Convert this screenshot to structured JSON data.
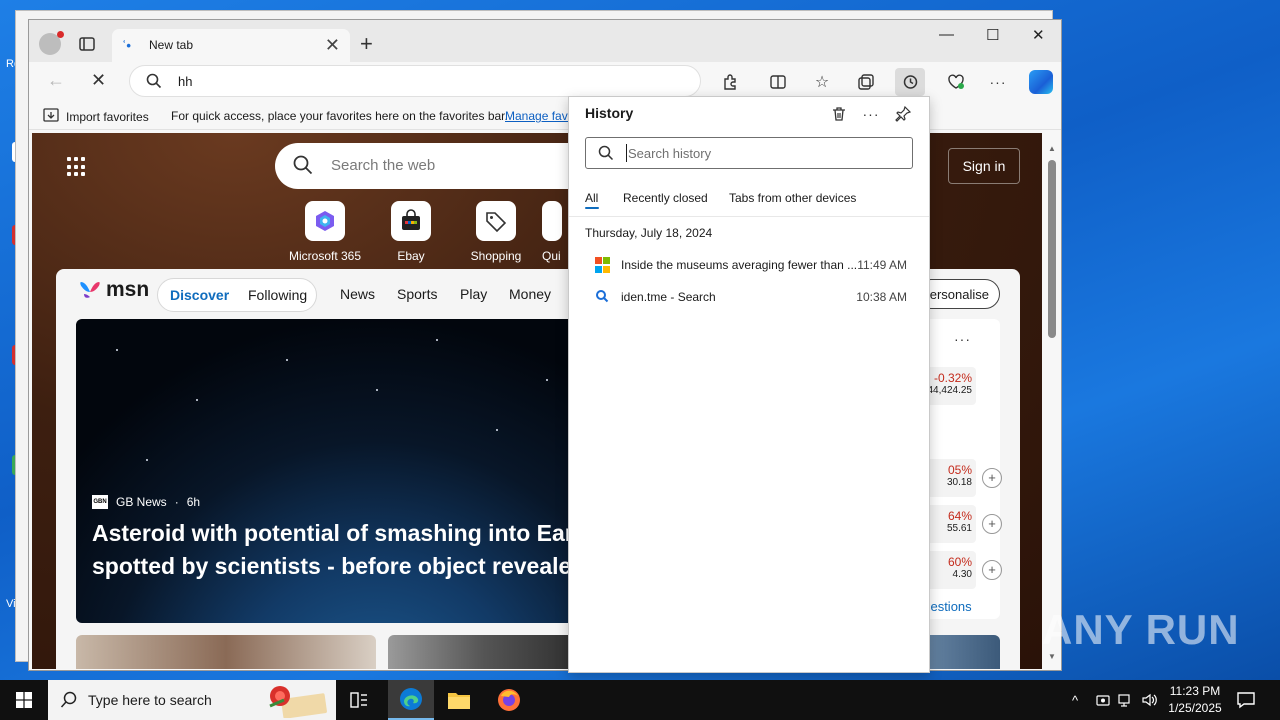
{
  "desktop": {
    "label_left_top": "Re",
    "label_left_bottom": "Vi"
  },
  "browser": {
    "tab": {
      "title": "New tab",
      "close_glyph": "✕"
    },
    "new_tab_glyph": "+",
    "window_controls": {
      "minimize": "—",
      "maximize": "☐",
      "close": "✕"
    },
    "address": {
      "value": "hh"
    },
    "favorites_bar": {
      "import_label": "Import favorites",
      "hint": "For quick access, place your favorites here on the favorites bar.",
      "manage_link": "Manage favo"
    }
  },
  "page": {
    "web_search_placeholder": "Search the web",
    "signin_label": "Sign in",
    "quick_links": [
      {
        "label": "Microsoft 365",
        "icon": "microsoft-365-icon"
      },
      {
        "label": "Ebay",
        "icon": "ebay-icon"
      },
      {
        "label": "Shopping",
        "icon": "shopping-tag-icon"
      },
      {
        "label": "Qui",
        "icon": "quick-link-icon"
      }
    ],
    "msn": {
      "logo_text": "msn",
      "pills": {
        "discover": "Discover",
        "following": "Following"
      },
      "nav": [
        "News",
        "Sports",
        "Play",
        "Money"
      ],
      "personalise": "ersonalise",
      "hero": {
        "source": "GB News",
        "age": "6h",
        "source_badge": "GBN",
        "title_line1": "Asteroid with potential of smashing into Ear",
        "title_line2": "spotted by scientists - before object reveale"
      },
      "stocks": {
        "headline": {
          "pct": "-0.32%",
          "value": "44,424.25"
        },
        "rows": [
          {
            "pct": "05%",
            "value": "30.18"
          },
          {
            "pct": "64%",
            "value": "55.61"
          },
          {
            "pct": "60%",
            "value": "4.30"
          }
        ],
        "suggestions_link": "ggestions"
      }
    }
  },
  "history": {
    "title": "History",
    "search_placeholder": "Search history",
    "tabs": {
      "all": "All",
      "recently_closed": "Recently closed",
      "other_devices": "Tabs from other devices"
    },
    "date_heading": "Thursday, July 18, 2024",
    "items": [
      {
        "title": "Inside the museums averaging fewer than ...",
        "time": "11:49 AM",
        "icon": "microsoft-logo-icon"
      },
      {
        "title": "iden.tme - Search",
        "time": "10:38 AM",
        "icon": "search-icon"
      }
    ]
  },
  "watermark": "ANY RUN",
  "taskbar": {
    "search_placeholder": "Type here to search",
    "clock_time": "11:23 PM",
    "clock_date": "1/25/2025"
  },
  "colors": {
    "accent": "#0f6cbd",
    "negative": "#c42b1c",
    "desktop": "#1a73d9"
  }
}
